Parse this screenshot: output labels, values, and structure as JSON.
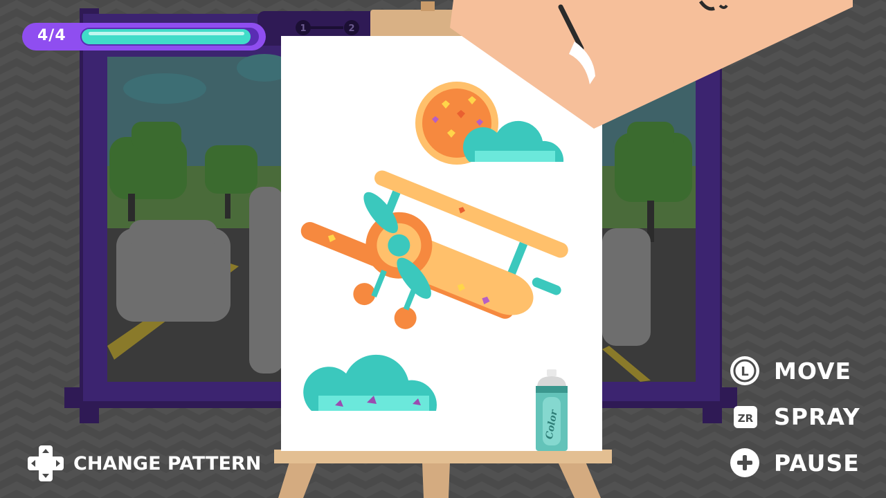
{
  "hud": {
    "progress": {
      "label": "4/4",
      "fraction": 0.96
    },
    "steps": [
      "1",
      "2"
    ]
  },
  "canvas": {
    "can_label": "Color"
  },
  "controls": {
    "move": {
      "icon": "l-stick-icon",
      "glyph": "L",
      "label": "MOVE"
    },
    "spray": {
      "icon": "zr-button-icon",
      "glyph": "ZR",
      "label": "SPRAY"
    },
    "pause": {
      "icon": "plus-button-icon",
      "glyph": "+",
      "label": "PAUSE"
    },
    "pattern": {
      "icon": "dpad-icon",
      "label": "CHANGE PATTERN"
    }
  },
  "colors": {
    "purple_frame": "#2f1a55",
    "orange": "#f6893f",
    "light_orange": "#ffc06b",
    "teal": "#3bc8bd",
    "skin": "#f6bf9a",
    "purple_ui": "#8f4ef0"
  }
}
